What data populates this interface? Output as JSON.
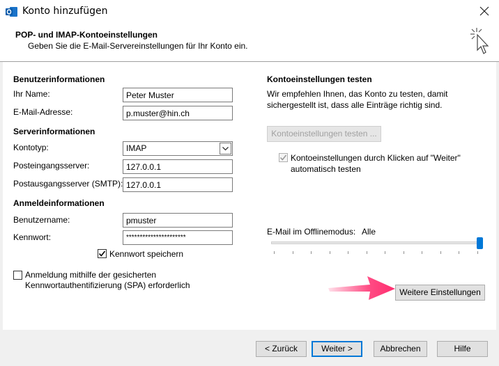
{
  "window": {
    "title": "Konto hinzufügen"
  },
  "header": {
    "title": "POP- und IMAP-Kontoeinstellungen",
    "subtitle": "Geben Sie die E-Mail-Servereinstellungen für Ihr Konto ein."
  },
  "user_info": {
    "section": "Benutzerinformationen",
    "name_label": "Ihr Name:",
    "name_value": "Peter Muster",
    "email_label": "E-Mail-Adresse:",
    "email_value": "p.muster@hin.ch"
  },
  "server_info": {
    "section": "Serverinformationen",
    "type_label": "Kontotyp:",
    "type_value": "IMAP",
    "incoming_label": "Posteingangsserver:",
    "incoming_value": "127.0.0.1",
    "outgoing_label": "Postausgangsserver (SMTP):",
    "outgoing_value": "127.0.0.1"
  },
  "login_info": {
    "section": "Anmeldeinformationen",
    "user_label": "Benutzername:",
    "user_value": "pmuster",
    "password_label": "Kennwort:",
    "password_value": "**********************",
    "save_password_label": "Kennwort speichern",
    "save_password_checked": true,
    "spa_label_line1": "Anmeldung mithilfe der gesicherten",
    "spa_label_line2": "Kennwortauthentifizierung (SPA) erforderlich",
    "spa_checked": false
  },
  "test": {
    "section": "Kontoeinstellungen testen",
    "desc_line1": "Wir empfehlen Ihnen, das Konto zu testen, damit",
    "desc_line2": "sichergestellt ist, dass alle Einträge richtig sind.",
    "test_button": "Kontoeinstellungen testen ...",
    "auto_test_line1": "Kontoeinstellungen durch Klicken auf \"Weiter\"",
    "auto_test_line2": "automatisch testen",
    "auto_test_checked": true
  },
  "offline": {
    "label": "E-Mail im Offlinemodus:",
    "value": "Alle",
    "slider_position": 1.0
  },
  "more_settings_button": "Weitere Einstellungen",
  "footer": {
    "back": "< Zurück",
    "next": "Weiter >",
    "cancel": "Abbrechen",
    "help": "Hilfe"
  },
  "colors": {
    "accent": "#0078d7",
    "annotation_arrow": "#ff2d6f"
  }
}
